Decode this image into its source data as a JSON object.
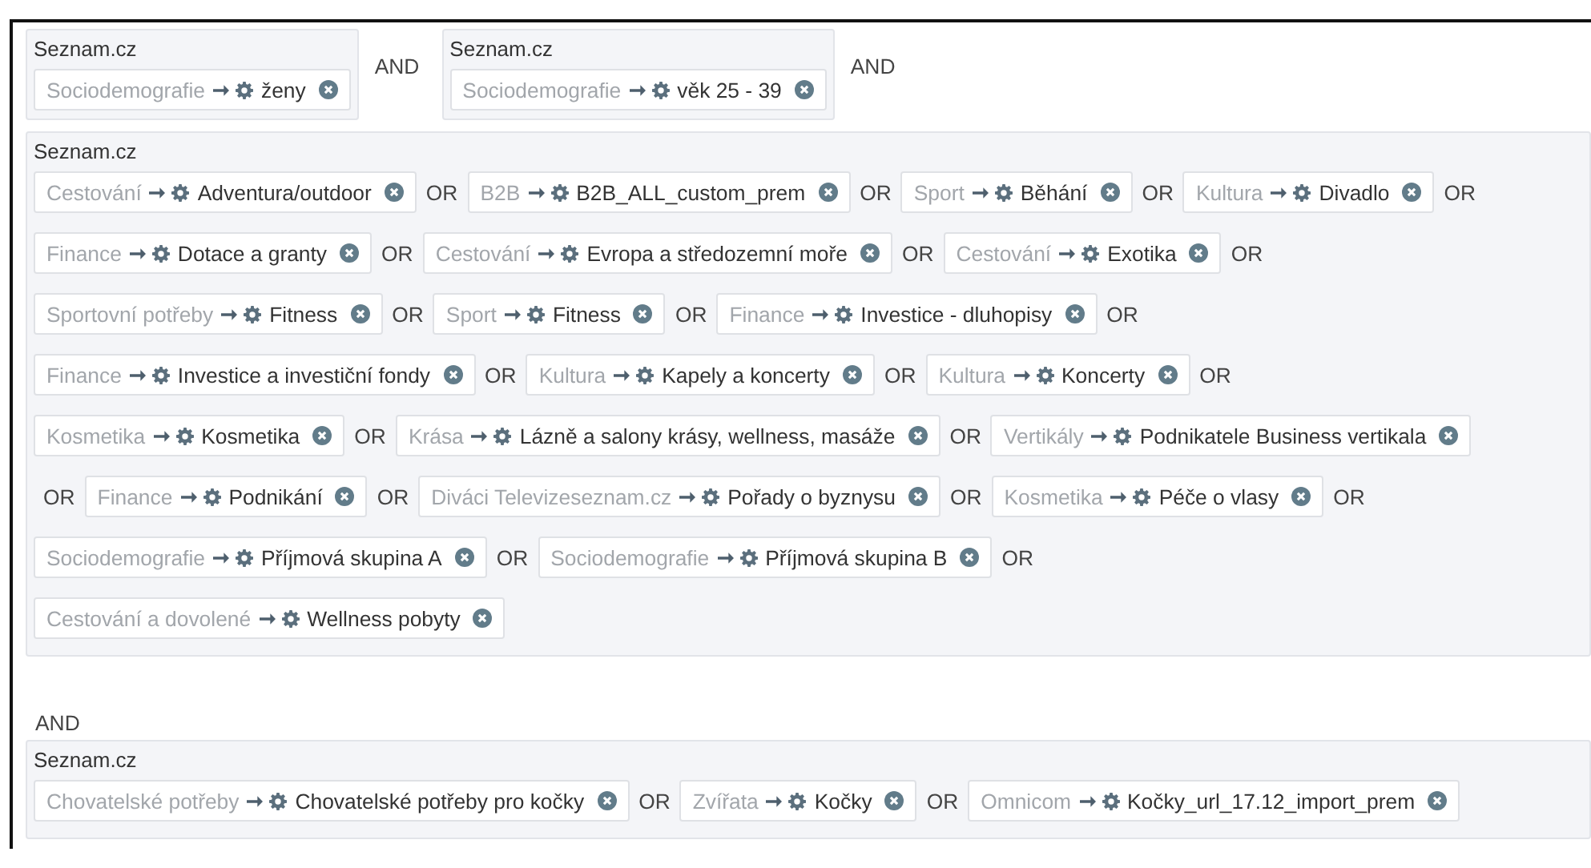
{
  "rows": [
    [
      {
        "kind": "group",
        "source": "Seznam.cz",
        "lines": [
          [
            {
              "kind": "chip",
              "category": "Sociodemografie",
              "value": "ženy"
            }
          ]
        ]
      },
      {
        "kind": "op",
        "text": "AND"
      },
      {
        "kind": "group",
        "source": "Seznam.cz",
        "lines": [
          [
            {
              "kind": "chip",
              "category": "Sociodemografie",
              "value": "věk 25 - 39"
            }
          ]
        ]
      },
      {
        "kind": "op",
        "text": "AND"
      }
    ],
    [
      {
        "kind": "group",
        "source": "Seznam.cz",
        "lines": [
          [
            {
              "kind": "chip",
              "category": "Cestování",
              "value": "Adventura/outdoor"
            },
            {
              "kind": "op",
              "text": "OR"
            },
            {
              "kind": "chip",
              "category": "B2B",
              "value": "B2B_ALL_custom_prem"
            },
            {
              "kind": "op",
              "text": "OR"
            },
            {
              "kind": "chip",
              "category": "Sport",
              "value": "Běhání"
            },
            {
              "kind": "op",
              "text": "OR"
            },
            {
              "kind": "chip",
              "category": "Kultura",
              "value": "Divadlo"
            },
            {
              "kind": "op",
              "text": "OR"
            }
          ],
          [
            {
              "kind": "chip",
              "category": "Finance",
              "value": "Dotace a granty"
            },
            {
              "kind": "op",
              "text": "OR"
            },
            {
              "kind": "chip",
              "category": "Cestování",
              "value": "Evropa a středozemní moře"
            },
            {
              "kind": "op",
              "text": "OR"
            },
            {
              "kind": "chip",
              "category": "Cestování",
              "value": "Exotika"
            },
            {
              "kind": "op",
              "text": "OR"
            }
          ],
          [
            {
              "kind": "chip",
              "category": "Sportovní potřeby",
              "value": "Fitness"
            },
            {
              "kind": "op",
              "text": "OR"
            },
            {
              "kind": "chip",
              "category": "Sport",
              "value": "Fitness"
            },
            {
              "kind": "op",
              "text": "OR"
            },
            {
              "kind": "chip",
              "category": "Finance",
              "value": "Investice - dluhopisy"
            },
            {
              "kind": "op",
              "text": "OR"
            }
          ],
          [
            {
              "kind": "chip",
              "category": "Finance",
              "value": "Investice a investiční fondy"
            },
            {
              "kind": "op",
              "text": "OR"
            },
            {
              "kind": "chip",
              "category": "Kultura",
              "value": "Kapely a koncerty"
            },
            {
              "kind": "op",
              "text": "OR"
            },
            {
              "kind": "chip",
              "category": "Kultura",
              "value": "Koncerty"
            },
            {
              "kind": "op",
              "text": "OR"
            }
          ],
          [
            {
              "kind": "chip",
              "category": "Kosmetika",
              "value": "Kosmetika"
            },
            {
              "kind": "op",
              "text": "OR"
            },
            {
              "kind": "chip",
              "category": "Krása",
              "value": "Lázně a salony krásy, wellness, masáže"
            },
            {
              "kind": "op",
              "text": "OR"
            },
            {
              "kind": "chip",
              "category": "Vertikály",
              "value": "Podnikatele Business vertikala"
            }
          ],
          [
            {
              "kind": "op",
              "text": "OR"
            },
            {
              "kind": "chip",
              "category": "Finance",
              "value": "Podnikání"
            },
            {
              "kind": "op",
              "text": "OR"
            },
            {
              "kind": "chip",
              "category": "Diváci Televizeseznam.cz",
              "value": "Pořady o byznysu"
            },
            {
              "kind": "op",
              "text": "OR"
            },
            {
              "kind": "chip",
              "category": "Kosmetika",
              "value": "Péče o vlasy"
            },
            {
              "kind": "op",
              "text": "OR"
            }
          ],
          [
            {
              "kind": "chip",
              "category": "Sociodemografie",
              "value": "Příjmová skupina A"
            },
            {
              "kind": "op",
              "text": "OR"
            },
            {
              "kind": "chip",
              "category": "Sociodemografie",
              "value": "Příjmová skupina B"
            },
            {
              "kind": "op",
              "text": "OR"
            }
          ],
          [
            {
              "kind": "chip",
              "category": "Cestování a dovolené",
              "value": "Wellness pobyty"
            }
          ]
        ]
      }
    ],
    [
      {
        "kind": "op",
        "text": "AND"
      }
    ],
    [
      {
        "kind": "group",
        "source": "Seznam.cz",
        "lines": [
          [
            {
              "kind": "chip",
              "category": "Chovatelské potřeby",
              "value": "Chovatelské potřeby pro kočky"
            },
            {
              "kind": "op",
              "text": "OR"
            },
            {
              "kind": "chip",
              "category": "Zvířata",
              "value": "Kočky"
            },
            {
              "kind": "op",
              "text": "OR"
            },
            {
              "kind": "chip",
              "category": "Omnicom",
              "value": "Kočky_url_17.12_import_prem"
            }
          ]
        ]
      }
    ]
  ]
}
